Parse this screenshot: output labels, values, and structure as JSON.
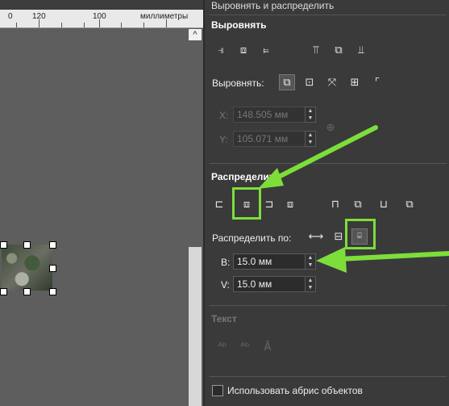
{
  "ruler": {
    "tick_120": "120",
    "tick_100": "100",
    "units": "миллиметры"
  },
  "canvas": {
    "scroll_up": "^"
  },
  "panel": {
    "title": "Выровнять и распределить",
    "align": {
      "section_title": "Выровнять",
      "buttons": [
        "align-left",
        "align-center-horizontal",
        "align-right",
        "align-top",
        "align-center-vertical",
        "align-bottom"
      ],
      "relative_label": "Выровнять:",
      "relative_buttons": [
        "selection",
        "page-center",
        "margins",
        "grid",
        "origin"
      ],
      "x_label": "X:",
      "x_value": "148.505 мм",
      "y_label": "Y:",
      "y_value": "105.071 мм"
    },
    "distribute": {
      "section_title": "Распределит",
      "by_label": "Распределить по:",
      "b_label": "B:",
      "b_value": "15.0 мм",
      "v_label": "V:",
      "v_value": "15.0 мм"
    },
    "text": {
      "section_title": "Текст"
    },
    "footer": {
      "use_outline_label": "Использовать абрис объектов"
    }
  },
  "colors": {
    "highlight": "#7dde3a",
    "panel_bg": "#3a3a3a"
  }
}
